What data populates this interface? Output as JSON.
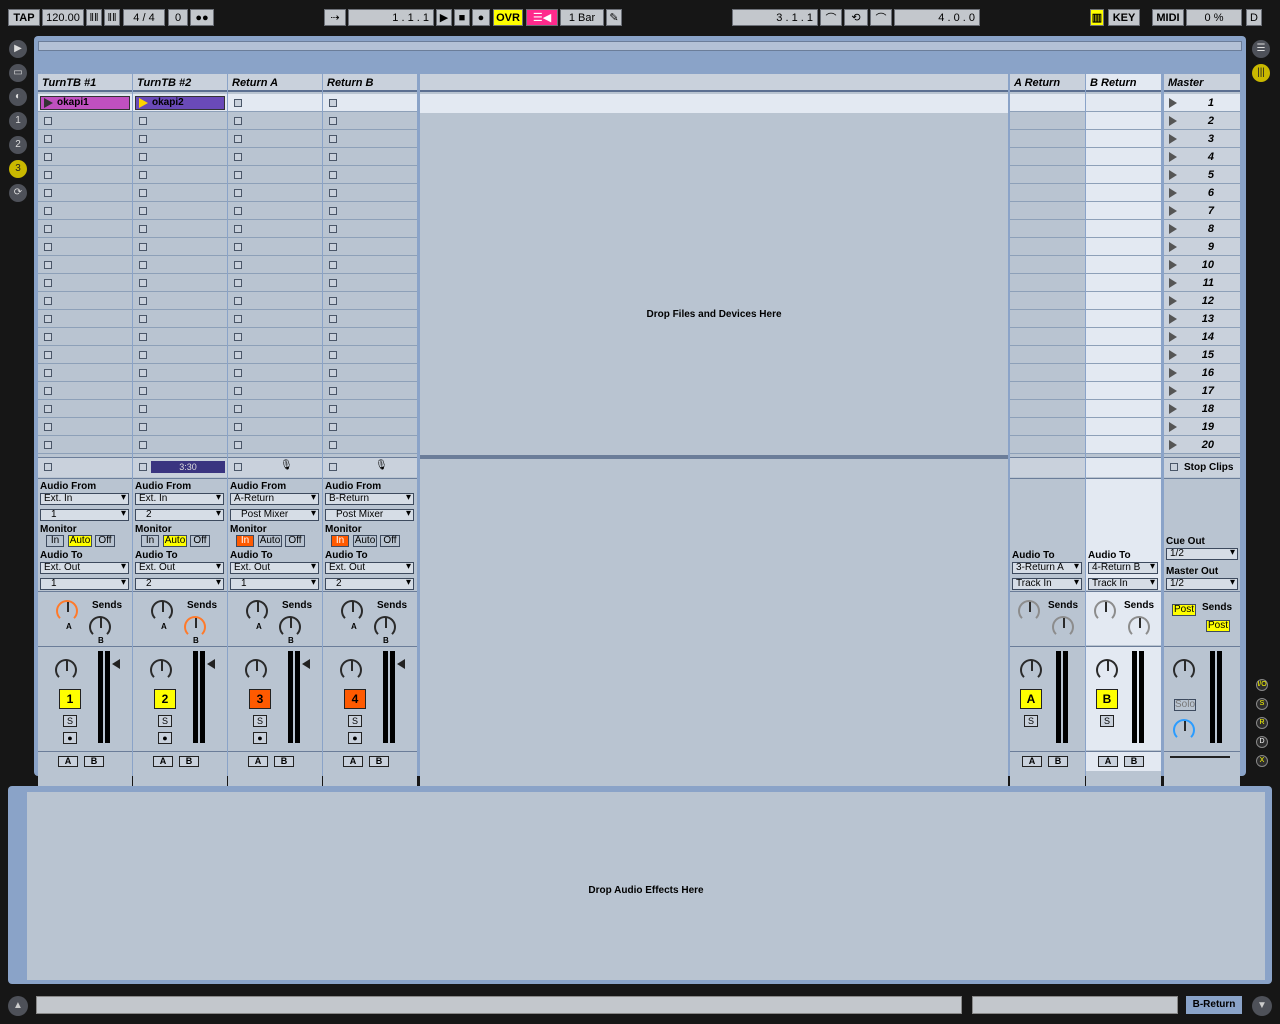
{
  "transport": {
    "tap": "TAP",
    "tempo": "120.00",
    "sig": "4 / 4",
    "zero": "0",
    "pos": "1 .  1 .  1",
    "ovr": "OVR",
    "quant": "1 Bar",
    "loop_start": "3 .  1 .  1",
    "loop_len": "4 .  0 .  0",
    "key": "KEY",
    "midi": "MIDI",
    "cpu": "0 %",
    "d": "D"
  },
  "tracks": [
    {
      "name": "TurnTB #1",
      "clip": "okapi1",
      "clip_color": "#c050c0",
      "audio_from": "Ext. In",
      "in_ch": "1",
      "audio_to": "Ext. Out",
      "out_ch": "1",
      "num": "1",
      "num_color": "#ffff00",
      "stop_time": ""
    },
    {
      "name": "TurnTB #2",
      "clip": "okapi2",
      "clip_color": "#6a4ab8",
      "audio_from": "Ext. In",
      "in_ch": "2",
      "audio_to": "Ext. Out",
      "out_ch": "2",
      "num": "2",
      "num_color": "#ffff00",
      "stop_time": "3:30"
    },
    {
      "name": "Return A",
      "clip": "",
      "clip_color": "",
      "audio_from": "A-Return",
      "in_ch": "Post Mixer",
      "audio_to": "Ext. Out",
      "out_ch": "1",
      "num": "3",
      "num_color": "#ff5a00",
      "stop_time": ""
    },
    {
      "name": "Return B",
      "clip": "",
      "clip_color": "",
      "audio_from": "B-Return",
      "in_ch": "Post Mixer",
      "audio_to": "Ext. Out",
      "out_ch": "2",
      "num": "4",
      "num_color": "#ff5a00",
      "stop_time": ""
    }
  ],
  "labels": {
    "audio_from": "Audio From",
    "monitor": "Monitor",
    "audio_to": "Audio To",
    "in": "In",
    "auto": "Auto",
    "off": "Off",
    "sends": "Sends",
    "s": "S",
    "a": "A",
    "b": "B",
    "drop_files": "Drop Files and Devices Here",
    "drop_effects": "Drop Audio Effects Here",
    "stop_clips": "Stop Clips",
    "cue_out": "Cue Out",
    "master_out": "Master Out",
    "post": "Post",
    "solo": "Solo",
    "track_in": "Track In"
  },
  "returns": [
    {
      "name": "A Return",
      "audio_to": "3-Return A",
      "num": "A"
    },
    {
      "name": "B Return",
      "audio_to": "4-Return B",
      "num": "B"
    }
  ],
  "master": {
    "name": "Master",
    "cue": "1/2",
    "out": "1/2",
    "scenes": [
      "1",
      "2",
      "3",
      "4",
      "5",
      "6",
      "7",
      "8",
      "9",
      "10",
      "11",
      "12",
      "13",
      "14",
      "15",
      "16",
      "17",
      "18",
      "19",
      "20"
    ]
  },
  "status": {
    "selected": "B-Return"
  }
}
